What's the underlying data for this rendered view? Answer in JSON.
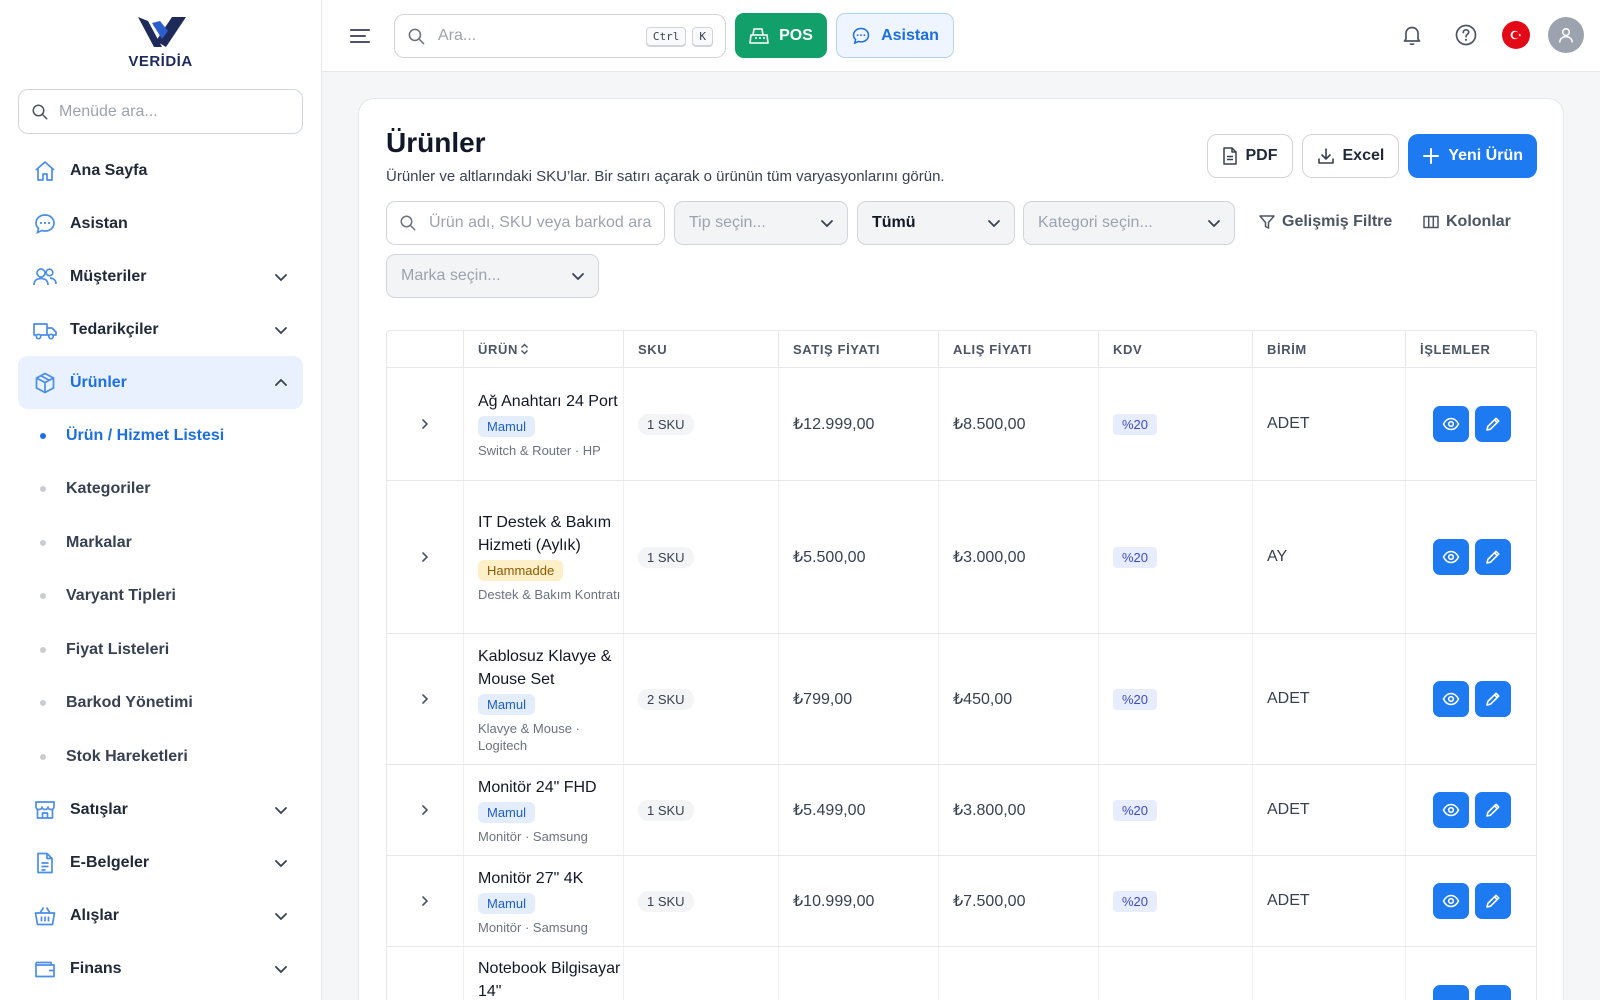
{
  "brand": {
    "name": "VERİDİA",
    "accent": "#1d7af0",
    "pos_color": "#12a06a"
  },
  "sidebar": {
    "search_placeholder": "Menüde ara...",
    "items": [
      {
        "label": "Ana Sayfa",
        "icon": "home-icon"
      },
      {
        "label": "Asistan",
        "icon": "chat-icon"
      },
      {
        "label": "Müşteriler",
        "icon": "users-icon",
        "expandable": true
      },
      {
        "label": "Tedarikçiler",
        "icon": "truck-icon",
        "expandable": true
      },
      {
        "label": "Ürünler",
        "icon": "box-icon",
        "expandable": true,
        "expanded": true,
        "active": true
      },
      {
        "label": "Satışlar",
        "icon": "store-icon",
        "expandable": true
      },
      {
        "label": "E-Belgeler",
        "icon": "document-icon",
        "expandable": true
      },
      {
        "label": "Alışlar",
        "icon": "basket-icon",
        "expandable": true
      },
      {
        "label": "Finans",
        "icon": "wallet-icon",
        "expandable": true
      }
    ],
    "subitems": [
      {
        "label": "Ürün / Hizmet Listesi",
        "active": true
      },
      {
        "label": "Kategoriler"
      },
      {
        "label": "Markalar"
      },
      {
        "label": "Varyant Tipleri"
      },
      {
        "label": "Fiyat Listeleri"
      },
      {
        "label": "Barkod Yönetimi"
      },
      {
        "label": "Stok Hareketleri"
      }
    ]
  },
  "topbar": {
    "search_placeholder": "Ara...",
    "kbd1": "Ctrl",
    "kbd2": "K",
    "pos_label": "POS",
    "assistant_label": "Asistan"
  },
  "page": {
    "title": "Ürünler",
    "subtitle": "Ürünler ve altlarındaki SKU’lar. Bir satırı açarak o ürünün tüm varyasyonlarını görün.",
    "pdf_label": "PDF",
    "excel_label": "Excel",
    "new_label": "Yeni Ürün"
  },
  "filters": {
    "search_placeholder": "Ürün adı, SKU veya barkod ara",
    "type_placeholder": "Tip seçin...",
    "status_value": "Tümü",
    "category_placeholder": "Kategori seçin...",
    "brand_placeholder": "Marka seçin...",
    "advanced_label": "Gelişmiş Filtre",
    "columns_label": "Kolonlar"
  },
  "table": {
    "headers": [
      "",
      "ÜRÜN",
      "SKU",
      "SATIŞ FİYATI",
      "ALIŞ FİYATI",
      "KDV",
      "BİRİM",
      "İŞLEMLER"
    ],
    "rows": [
      {
        "name": "Ağ Anahtarı 24 Port",
        "tag": "Mamul",
        "tag_type": "mamul",
        "meta": "Switch & Router · HP",
        "sku": "1 SKU",
        "sale": "₺12.999,00",
        "buy": "₺8.500,00",
        "kdv": "%20",
        "unit": "ADET"
      },
      {
        "name": "IT Destek & Bakım Hizmeti (Aylık)",
        "tag": "Hammadde",
        "tag_type": "ham",
        "meta": "Destek & Bakım Kontratı",
        "sku": "1 SKU",
        "sale": "₺5.500,00",
        "buy": "₺3.000,00",
        "kdv": "%20",
        "unit": "AY"
      },
      {
        "name": "Kablosuz Klavye & Mouse Set",
        "tag": "Mamul",
        "tag_type": "mamul",
        "meta": "Klavye & Mouse · Logitech",
        "sku": "2 SKU",
        "sale": "₺799,00",
        "buy": "₺450,00",
        "kdv": "%20",
        "unit": "ADET"
      },
      {
        "name": "Monitör 24\" FHD",
        "tag": "Mamul",
        "tag_type": "mamul",
        "meta": "Monitör · Samsung",
        "sku": "1 SKU",
        "sale": "₺5.499,00",
        "buy": "₺3.800,00",
        "kdv": "%20",
        "unit": "ADET"
      },
      {
        "name": "Monitör 27\" 4K",
        "tag": "Mamul",
        "tag_type": "mamul",
        "meta": "Monitör · Samsung",
        "sku": "1 SKU",
        "sale": "₺10.999,00",
        "buy": "₺7.500,00",
        "kdv": "%20",
        "unit": "ADET"
      },
      {
        "name": "Notebook Bilgisayar 14\"",
        "tag": "",
        "tag_type": "",
        "meta": "",
        "sku": "",
        "sale": "",
        "buy": "",
        "kdv": "",
        "unit": ""
      }
    ]
  }
}
